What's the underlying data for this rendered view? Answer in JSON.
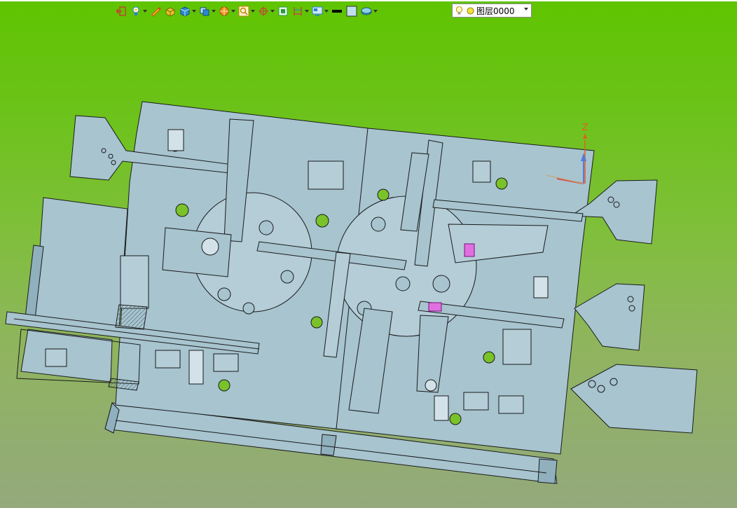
{
  "toolbar": {
    "buttons": [
      {
        "name": "exit-icon",
        "color": "#cc3333"
      },
      {
        "name": "lightbulb-pin-icon",
        "color": "#2a7fd0"
      },
      {
        "name": "pencil-icon",
        "color": "#d04a2a"
      },
      {
        "name": "box-yellow-icon",
        "color": "#e8c12a"
      },
      {
        "name": "cube-blue-icon",
        "color": "#2a8ad0"
      },
      {
        "name": "view-cube-icon",
        "color": "#2a8ad0"
      },
      {
        "name": "orange-sphere-icon",
        "color": "#f0901a"
      },
      {
        "name": "zoom-fit-icon",
        "color": "#e0a020"
      },
      {
        "name": "rotate-axes-icon",
        "color": "#d03a3a"
      },
      {
        "name": "frame-icon",
        "color": "#2a9a4a"
      },
      {
        "name": "dimension-icon",
        "color": "#d03a3a"
      },
      {
        "name": "display-mode-icon",
        "color": "#2a7fd0"
      },
      {
        "name": "line-weight-icon",
        "color": "#000000"
      },
      {
        "name": "background-color-icon",
        "color": "#bfe1ef"
      },
      {
        "name": "material-icon",
        "color": "#3aa0c8"
      }
    ]
  },
  "layer": {
    "label": "图层0000",
    "icons": [
      "lightbulb-icon",
      "yellow-circle-icon"
    ]
  },
  "viewport": {
    "triad_axis_label": "Z",
    "background_top": "#5fc400",
    "background_bottom": "#94a97c",
    "model_color": "#a7c4cf",
    "edge_color": "#1a1a1a"
  }
}
